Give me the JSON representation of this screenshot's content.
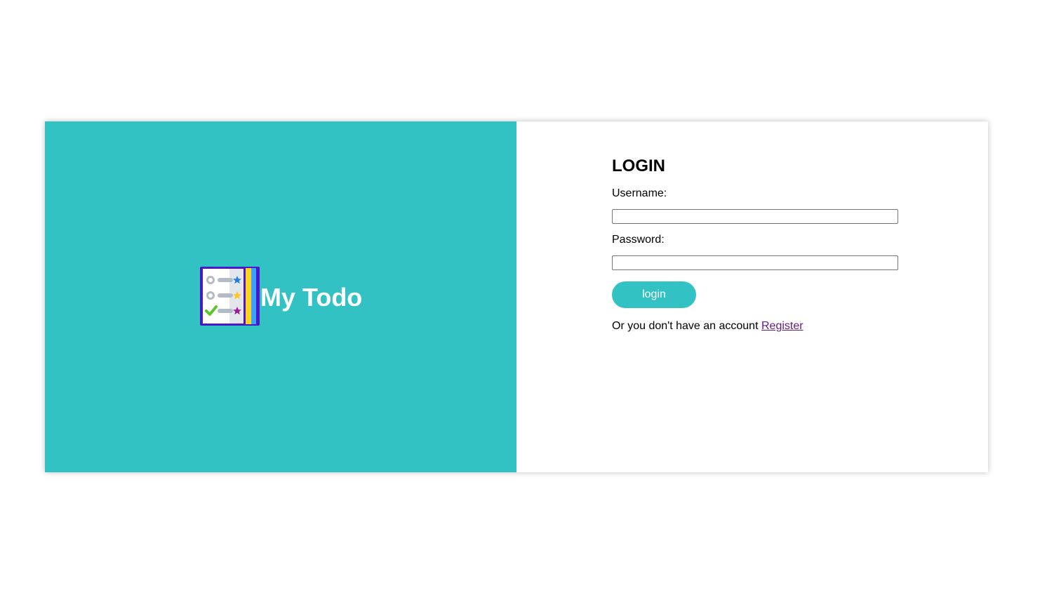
{
  "brand": {
    "title": "My Todo",
    "logo_icon": "todo-list-book-icon",
    "background_color": "#33c2c3"
  },
  "login": {
    "heading": "LOGIN",
    "username_label": "Username:",
    "username_value": "",
    "password_label": "Password:",
    "password_value": "",
    "submit_label": "login",
    "register_prompt": "Or you don't have an account",
    "register_link": "Register",
    "accent_color": "#33c2c3",
    "link_color": "#681a88"
  }
}
